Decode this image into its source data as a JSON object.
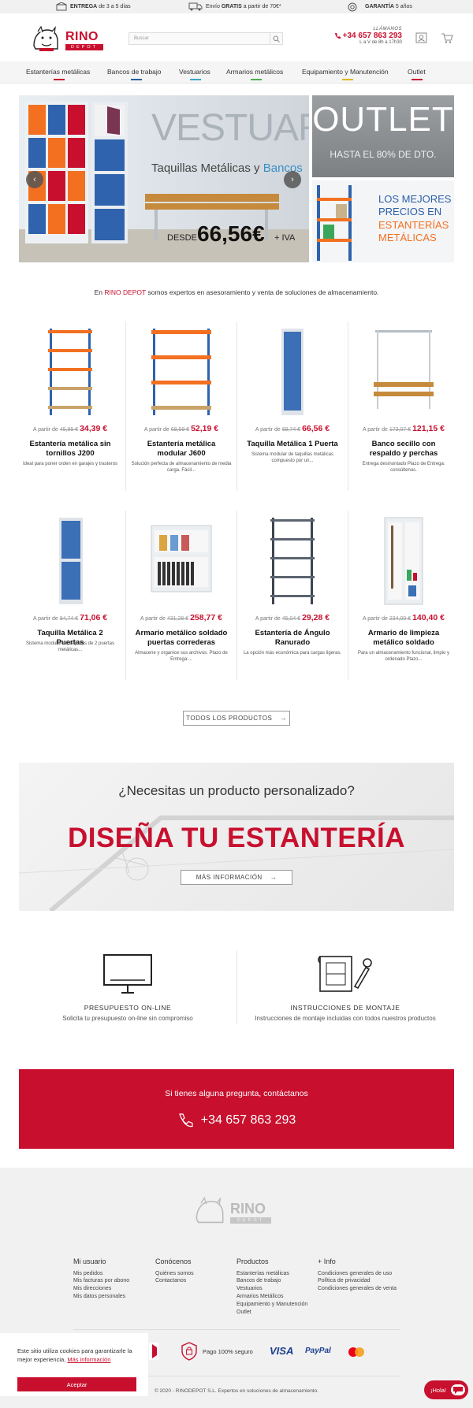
{
  "topbar": {
    "items": [
      {
        "bold": "ENTREGA",
        "rest": "de 3 a 5 días"
      },
      {
        "pre": "Envío",
        "bold": "GRATIS",
        "rest": "a partir de 70€*"
      },
      {
        "bold": "GARANTÍA",
        "rest": "5 años"
      }
    ]
  },
  "header": {
    "logo_text": "RINO",
    "logo_sub": "DEPOT",
    "search_placeholder": "Buscar",
    "phone_label": "LLÁMANOS",
    "phone_number": "+34 657 863 293",
    "phone_hours": "L a V de 8h a 17h30"
  },
  "nav": {
    "items": [
      {
        "label": "Estanterías metálicas",
        "color": "#c8102e"
      },
      {
        "label": "Bancos de trabajo",
        "color": "#2a5f9e"
      },
      {
        "label": "Vestuarios",
        "color": "#3aa7c9"
      },
      {
        "label": "Armarios metálicos",
        "color": "#4caf50"
      },
      {
        "label": "Equipamiento y Manutención",
        "color": "#e0b800"
      },
      {
        "label": "Outlet",
        "color": "#c8102e"
      }
    ]
  },
  "banner": {
    "main_title": "VESTUARIOS",
    "main_sub_a": "Taquillas Metálicas y",
    "main_sub_b": "Bancos",
    "main_price_label": "DESDE",
    "main_price": "66,56€",
    "main_price_tax": "+ IVA",
    "outlet_title": "OUTLET",
    "outlet_sub": "HASTA EL 80% DE DTO.",
    "side_l1": "LOS MEJORES",
    "side_l2": "PRECIOS EN",
    "side_l3": "ESTANTERÍAS",
    "side_l4": "METÁLICAS"
  },
  "intro": {
    "pre": "En",
    "brand": "RINO DEPOT",
    "post": "somos expertos en asesoramiento y venta de soluciones de almacenamiento."
  },
  "products": [
    {
      "from": "A partir de",
      "old": "45,85 €",
      "price": "34,39 €",
      "name": "Estantería metálica sin tornillos J200",
      "desc": "Ideal para poner orden en garajes y trasteros"
    },
    {
      "from": "A partir de",
      "old": "69,59 €",
      "price": "52,19 €",
      "name": "Estantería metálica modular J600",
      "desc": "Solución perfecta de almacenamiento de media carga. Fácil..."
    },
    {
      "from": "A partir de",
      "old": "88,74 €",
      "price": "66,56 €",
      "name": "Taquilla Metálica 1 Puerta",
      "desc": "Sistema modular de taquillas metálicas compuesto por un..."
    },
    {
      "from": "A partir de",
      "old": "173,07 €",
      "price": "121,15 €",
      "name": "Banco secillo con respaldo y perchas",
      "desc": "Entrega desmontado Plazo de Entrega: consúltenos."
    },
    {
      "from": "A partir de",
      "old": "94,74 €",
      "price": "71,06 €",
      "name": "Taquilla Metálica 2 Puertas",
      "desc": "Sistema modular de taquillas de 2 puertas metálicas..."
    },
    {
      "from": "A partir de",
      "old": "431,28 €",
      "price": "258,77 €",
      "name": "Armario metálico soldado puertas correderas",
      "desc": "Almacene y organice sus archivos. Plazo de Entrega:..."
    },
    {
      "from": "A partir de",
      "old": "45,04 €",
      "price": "29,28 €",
      "name": "Estantería de Ángulo Ranurado",
      "desc": "La opción más económica para cargas ligeras."
    },
    {
      "from": "A partir de",
      "old": "234,00 €",
      "price": "140,40 €",
      "name": "Armario de limpieza metálico soldado",
      "desc": "Para un almacenamiento funcional, limpio y ordenado Plazo..."
    }
  ],
  "all_products_label": "TODOS LOS PRODUCTOS",
  "custom": {
    "question": "¿Necesitas un producto personalizado?",
    "headline": "DISEÑA TU ESTANTERÍA",
    "button": "MÁS INFORMACIÓN"
  },
  "services": [
    {
      "title": "PRESUPUESTO ON-LINE",
      "desc": "Solicita tu presupuesto on-line sin compromiso"
    },
    {
      "title": "INSTRUCCIONES DE MONTAJE",
      "desc": "Instrucciones de montaje incluidas con todos nuestros productos"
    }
  ],
  "contact": {
    "title": "Si tienes alguna pregunta, contáctanos",
    "phone": "+34 657 863 293"
  },
  "footer": {
    "cols": [
      {
        "title": "Mi usuario",
        "links": [
          "Mis pedidos",
          "Mis facturas por abono",
          "Mis direcciones",
          "Mis datos personales"
        ]
      },
      {
        "title": "Conócenos",
        "links": [
          "Quiénes somos",
          "Contactanos"
        ]
      },
      {
        "title": "Productos",
        "links": [
          "Estanterías metálicas",
          "Bancos de trabajo",
          "Vestuarios",
          "Armarios Metálicos",
          "Equipamiento y Manutención",
          "Outlet"
        ]
      },
      {
        "title": "+ Info",
        "links": [
          "Condiciones generales de uso",
          "Política de privacidad",
          "Condiciones generales de venta"
        ]
      }
    ],
    "secure_label": "Pago 100% seguro",
    "visa": "VISA",
    "paypal": "PayPal",
    "copyright": "© 2020 - RINODEPOT S.L. Expertos en soluciones de almacenamiento."
  },
  "cookie": {
    "text": "Este sitio utiliza cookies para garantizarle la mejor experiencia.",
    "link": "Más información",
    "accept": "Aceptar"
  },
  "chat": {
    "label": "¡Hola!"
  }
}
